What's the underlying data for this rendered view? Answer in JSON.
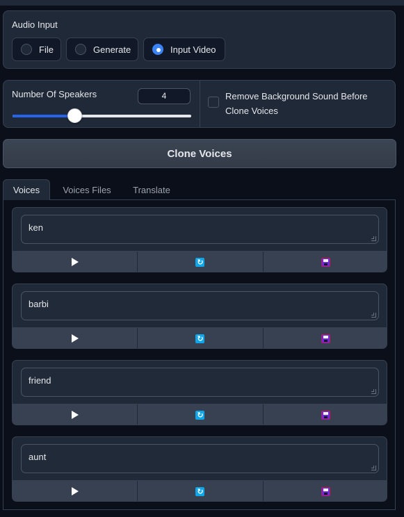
{
  "audio_input": {
    "label": "Audio Input",
    "options": [
      {
        "label": "File",
        "selected": false
      },
      {
        "label": "Generate",
        "selected": false
      },
      {
        "label": "Input Video",
        "selected": true
      }
    ]
  },
  "speakers": {
    "label": "Number Of Speakers",
    "value": "4",
    "slider_fraction": 0.35
  },
  "remove_bg": {
    "label": "Remove Background Sound Before Clone Voices",
    "checked": false
  },
  "clone_button": "Clone Voices",
  "tabs": [
    {
      "label": "Voices",
      "active": true
    },
    {
      "label": "Voices Files",
      "active": false
    },
    {
      "label": "Translate",
      "active": false
    }
  ],
  "voices": [
    {
      "text": "ken"
    },
    {
      "text": "barbi"
    },
    {
      "text": "friend"
    },
    {
      "text": "aunt"
    }
  ],
  "icons": {
    "play": "play-icon",
    "regenerate": "refresh-icon",
    "save": "save-icon"
  },
  "colors": {
    "accent": "#2563eb",
    "background": "#0b0f19",
    "panel": "#1f2937"
  }
}
